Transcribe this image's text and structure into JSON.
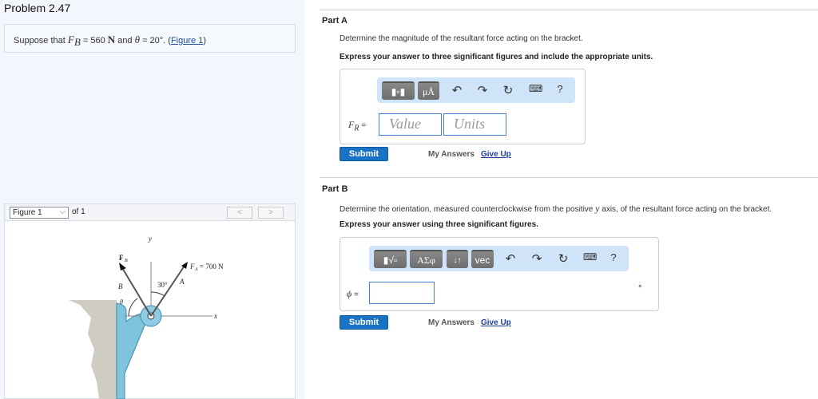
{
  "problem": {
    "title": "Problem 2.47",
    "statement_pre": "Suppose that ",
    "fb_sym": "F",
    "fb_sub": "B",
    "fb_val": " = 560 ",
    "unit_n": "N",
    "and": " and ",
    "theta": "θ",
    "theta_val": " = 20°. (",
    "figure_link": "Figure 1",
    ")": ")"
  },
  "figure": {
    "select": "Figure 1",
    "of": "of 1",
    "prev": "<",
    "next": ">",
    "labels": {
      "y": "y",
      "x": "x",
      "fb": "F",
      "fb_sub": "B",
      "fa": "F",
      "fa_sub": "A",
      "fa_val": "= 700 N",
      "b": "B",
      "a": "A",
      "angle": "30°",
      "theta": "θ"
    }
  },
  "partA": {
    "title": "Part A",
    "question": "Determine the magnitude of the resultant force acting on the bracket.",
    "instruction": "Express your answer to three significant figures and include the appropriate units.",
    "toolbar": {
      "units_btn": "μÅ",
      "help": "?"
    },
    "label": "F",
    "label_sub": "R",
    "eq": " =",
    "value_placeholder": "Value",
    "units_placeholder": "Units",
    "submit": "Submit",
    "my_answers": "My Answers",
    "give_up": "Give Up"
  },
  "partB": {
    "title": "Part B",
    "question_pre": "Determine the orientation, measured counterclockwise from the positive ",
    "axis": "y",
    "question_post": " axis, of the resultant force acting on the bracket.",
    "instruction": "Express your answer using three significant figures.",
    "toolbar": {
      "greek_btn": "ΑΣφ",
      "sort_btn": "↓↑",
      "vec_btn": "vec",
      "help": "?"
    },
    "label": "ϕ",
    "eq": " =",
    "unit": "°",
    "submit": "Submit",
    "my_answers": "My Answers",
    "give_up": "Give Up"
  }
}
